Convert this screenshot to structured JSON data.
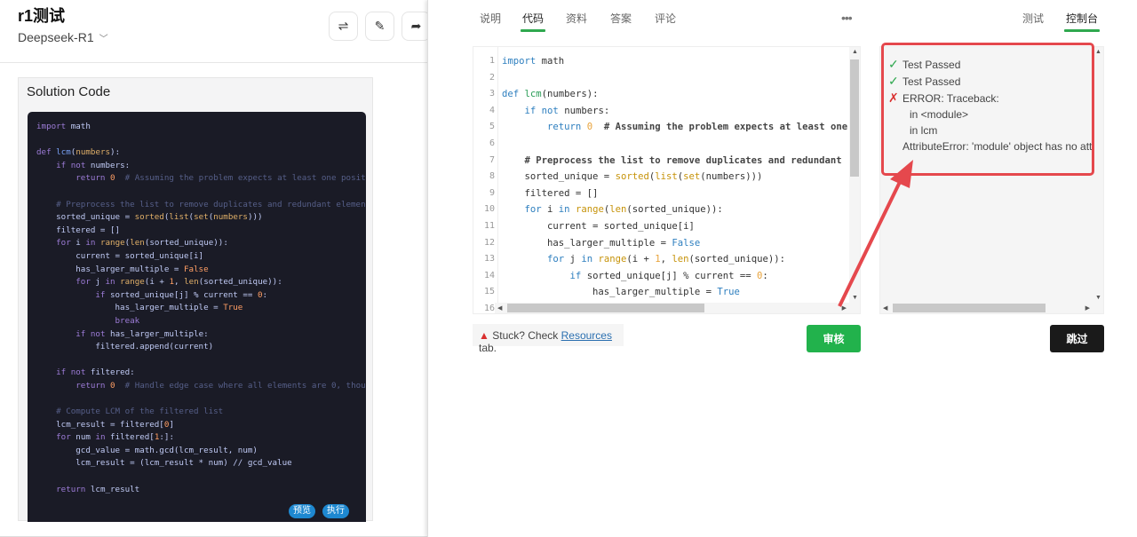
{
  "header": {
    "title": "r1测试",
    "model": "Deepseek-R1",
    "buttons": [
      {
        "icon": "swap-icon",
        "glyph": "⇌"
      },
      {
        "icon": "pencil-icon",
        "glyph": "✎"
      },
      {
        "icon": "share-icon",
        "glyph": "➦"
      }
    ]
  },
  "solution": {
    "title": "Solution Code",
    "preview_label": "预览",
    "run_label": "执行"
  },
  "code": [
    "import math",
    "",
    "def lcm(numbers):",
    "    if not numbers:",
    "        return 0  # Assuming the problem expects at least one posit",
    "",
    "    # Preprocess the list to remove duplicates and redundant elemen",
    "    sorted_unique = sorted(list(set(numbers)))",
    "    filtered = []",
    "    for i in range(len(sorted_unique)):",
    "        current = sorted_unique[i]",
    "        has_larger_multiple = False",
    "        for j in range(i + 1, len(sorted_unique)):",
    "            if sorted_unique[j] % current == 0:",
    "                has_larger_multiple = True",
    "                break",
    "        if not has_larger_multiple:",
    "            filtered.append(current)",
    "",
    "    if not filtered:",
    "        return 0  # Handle edge case where all elements are 0, thou",
    "",
    "    # Compute LCM of the filtered list",
    "    lcm_result = filtered[0]",
    "    for num in filtered[1:]:",
    "        gcd_value = math.gcd(lcm_result, num)",
    "        lcm_result = (lcm_result * num) // gcd_value",
    "",
    "    return lcm_result"
  ],
  "editor": {
    "visible_lines": 16
  },
  "tabs": {
    "left": [
      {
        "label": "说明",
        "active": false
      },
      {
        "label": "代码",
        "active": true
      },
      {
        "label": "资料",
        "active": false
      },
      {
        "label": "答案",
        "active": false
      },
      {
        "label": "评论",
        "active": false
      }
    ],
    "more": "•••",
    "right": [
      {
        "label": "测试",
        "active": false
      },
      {
        "label": "控制台",
        "active": true
      }
    ]
  },
  "console": {
    "lines": [
      {
        "status": "pass",
        "icon": "check-icon",
        "text": "Test Passed"
      },
      {
        "status": "pass",
        "icon": "check-icon",
        "text": "Test Passed"
      },
      {
        "status": "error",
        "icon": "cross-icon",
        "text": "ERROR: Traceback:"
      },
      {
        "status": "detail",
        "text": "in <module>"
      },
      {
        "status": "detail",
        "text": "in lcm"
      },
      {
        "status": "message",
        "text": "AttributeError: 'module' object has no attri"
      }
    ]
  },
  "footer": {
    "stuck_prefix": "Stuck? Check ",
    "stuck_link": "Resources",
    "stuck_suffix": " tab.",
    "review_label": "审核",
    "skip_label": "跳过"
  },
  "colors": {
    "accent_green": "#2fa84f",
    "review_button": "#22b24c",
    "skip_button": "#1a1a1a",
    "annotation_red": "#e5484d",
    "code_bg": "#1a1b26"
  }
}
